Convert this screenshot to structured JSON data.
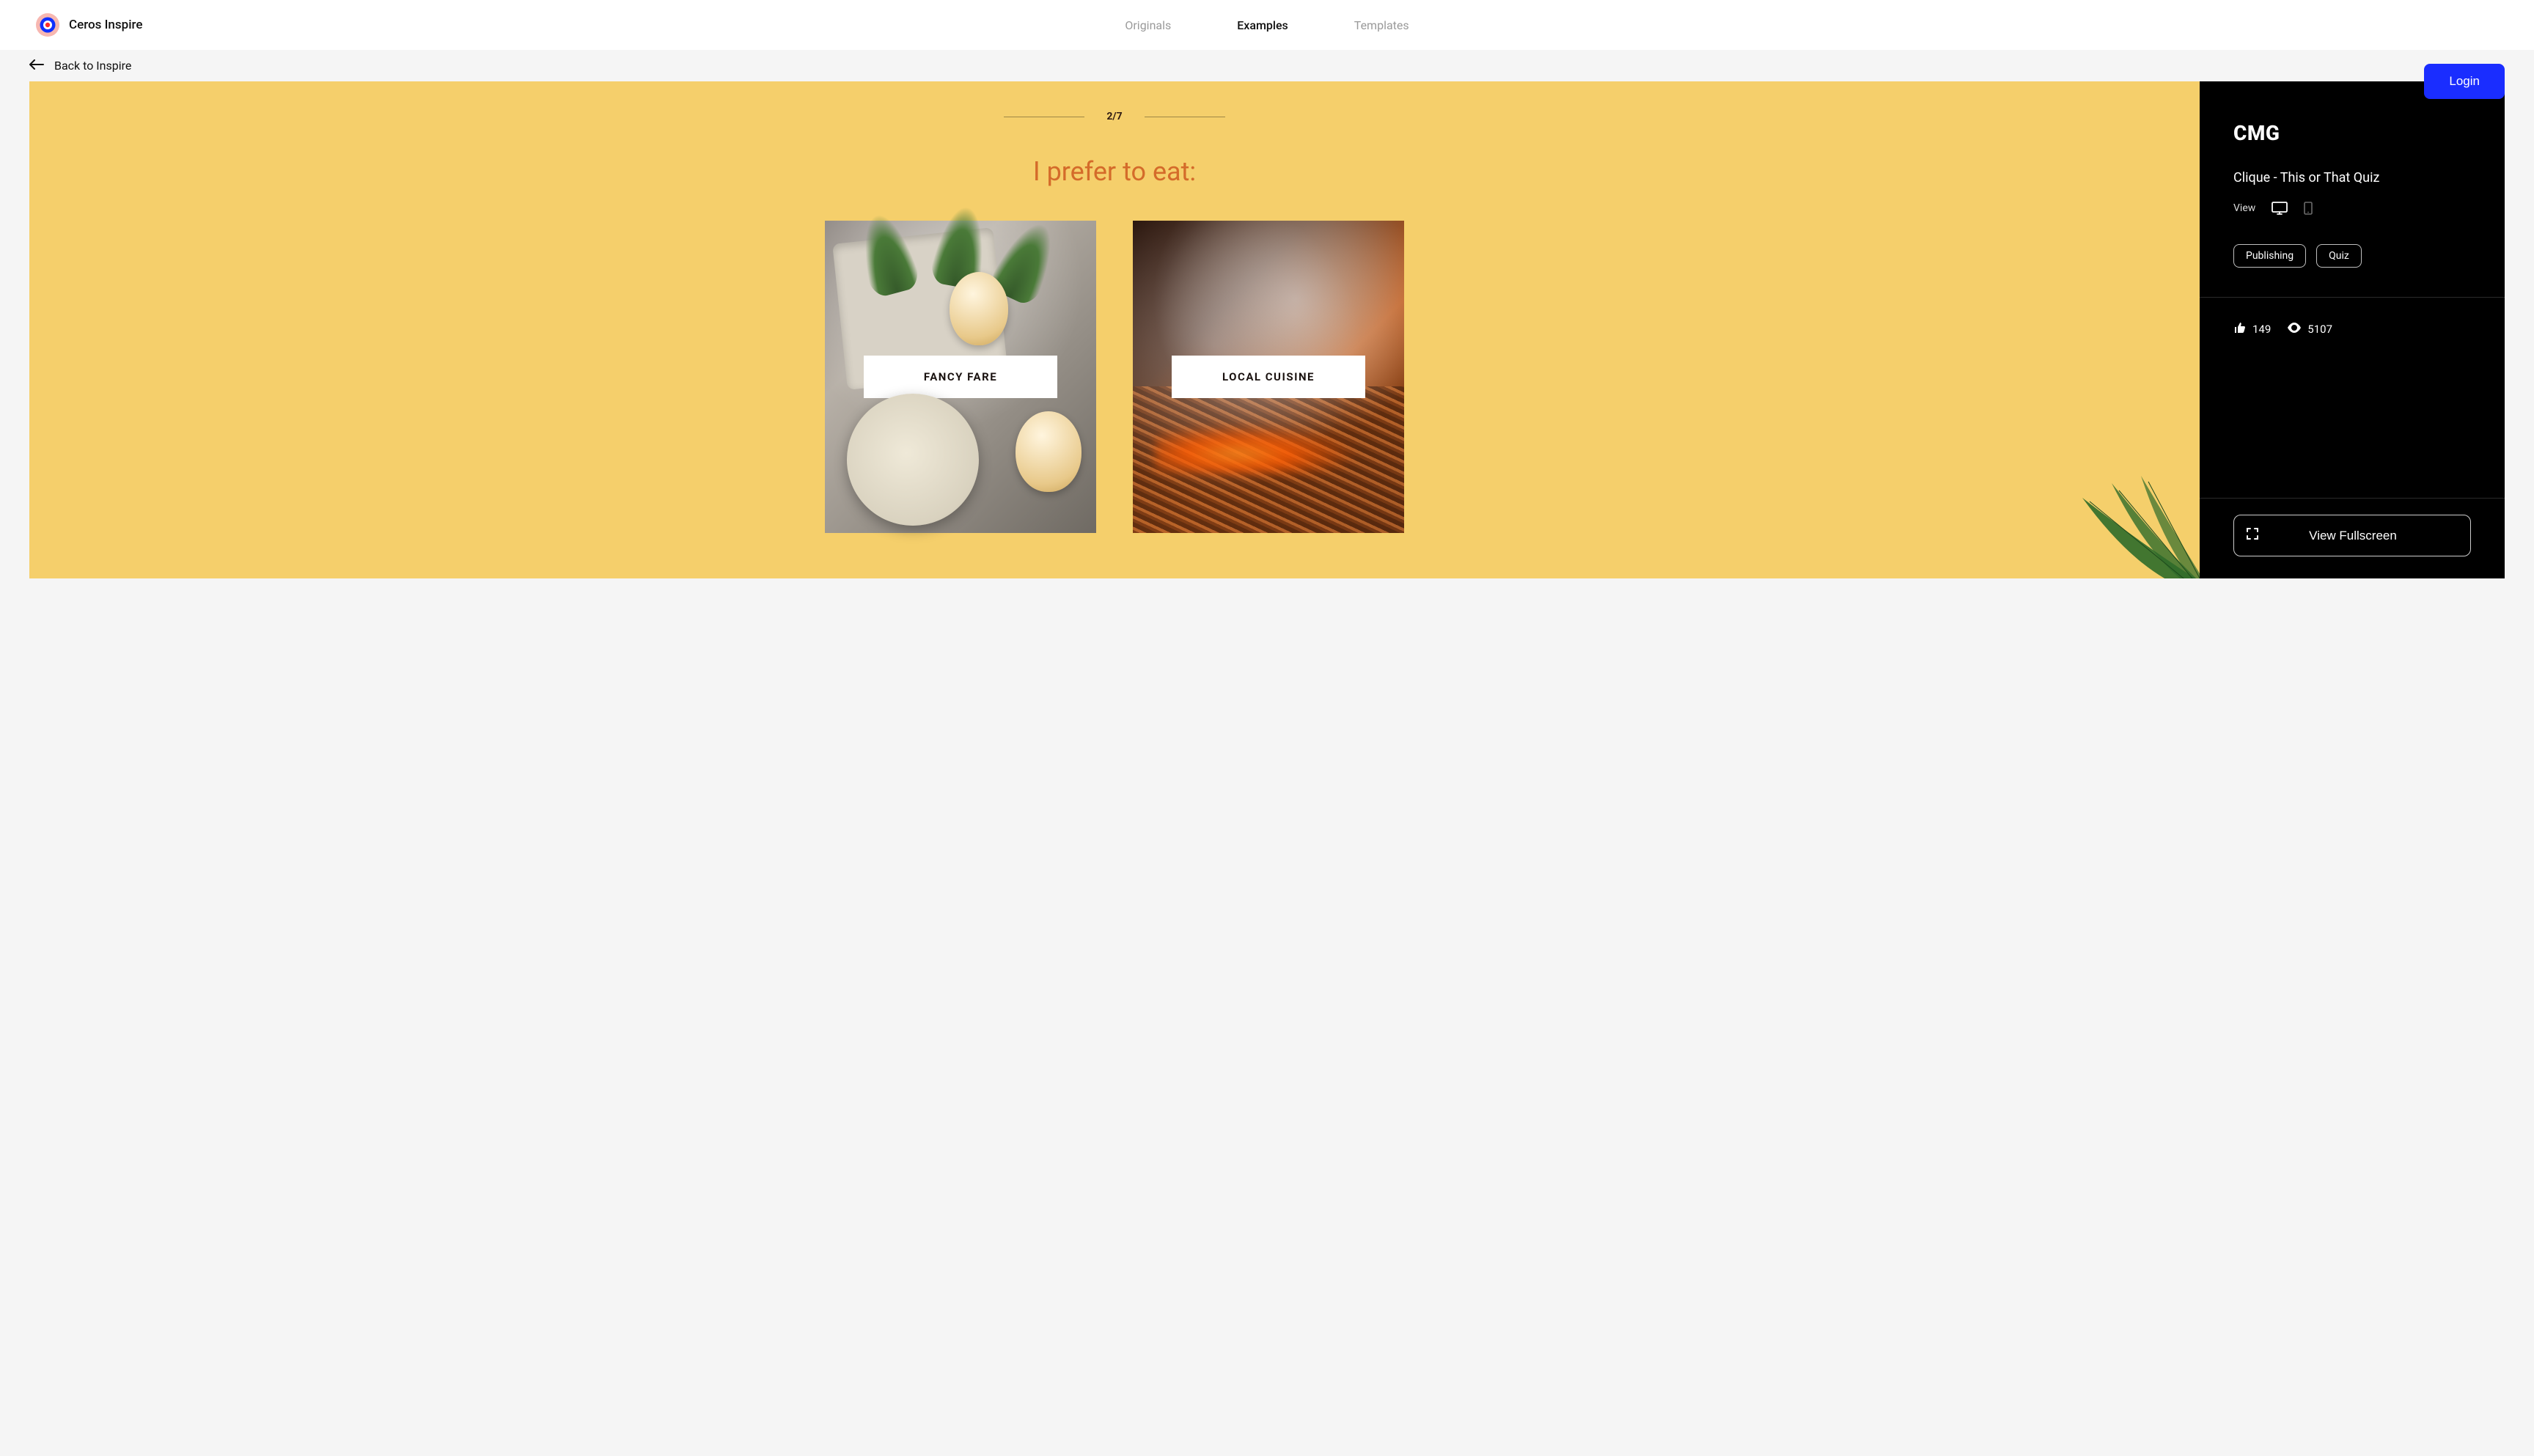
{
  "header": {
    "brand": "Ceros Inspire",
    "nav": {
      "originals": "Originals",
      "examples": "Examples",
      "templates": "Templates"
    }
  },
  "subbar": {
    "back_label": "Back to Inspire"
  },
  "login_label": "Login",
  "quiz": {
    "progress": "2/7",
    "question": "I prefer to eat:",
    "option_a_label": "FANCY FARE",
    "option_b_label": "LOCAL CUISINE"
  },
  "detail": {
    "brand": "CMG",
    "title": "Clique - This or That Quiz",
    "view_label": "View",
    "tags": {
      "publishing": "Publishing",
      "quiz": "Quiz"
    },
    "likes": "149",
    "views": "5107",
    "fullscreen_label": "View Fullscreen"
  }
}
